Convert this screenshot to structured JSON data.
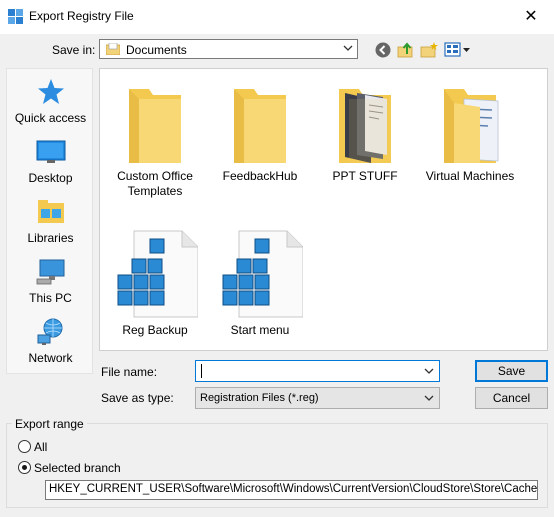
{
  "window": {
    "title": "Export Registry File",
    "close_glyph": "✕"
  },
  "savein": {
    "label": "Save in:",
    "value": "Documents"
  },
  "toolbar": {
    "icons": [
      "back-icon",
      "up-folder-icon",
      "new-folder-icon",
      "view-menu-icon"
    ]
  },
  "places": [
    {
      "label": "Quick access",
      "icon": "quick-access-star-icon"
    },
    {
      "label": "Desktop",
      "icon": "desktop-icon"
    },
    {
      "label": "Libraries",
      "icon": "libraries-icon"
    },
    {
      "label": "This PC",
      "icon": "this-pc-icon"
    },
    {
      "label": "Network",
      "icon": "network-icon"
    }
  ],
  "files": [
    {
      "name": "Custom Office Templates",
      "type": "folder"
    },
    {
      "name": "FeedbackHub",
      "type": "folder"
    },
    {
      "name": "PPT STUFF",
      "type": "folder"
    },
    {
      "name": "Virtual Machines",
      "type": "folder"
    },
    {
      "name": "Reg Backup",
      "type": "reg-file"
    },
    {
      "name": "Start menu",
      "type": "reg-file"
    }
  ],
  "filename": {
    "label": "File name:",
    "value": ""
  },
  "filetype": {
    "label": "Save as type:",
    "value": "Registration Files (*.reg)"
  },
  "buttons": {
    "save": "Save",
    "cancel": "Cancel"
  },
  "export_range": {
    "title": "Export range",
    "all_label": "All",
    "selected_label": "Selected branch",
    "selected": "Selected branch",
    "branch_value": "HKEY_CURRENT_USER\\Software\\Microsoft\\Windows\\CurrentVersion\\CloudStore\\Store\\Cache\\Def"
  },
  "colors": {
    "folder": "#f8d775",
    "accent": "#0078d7",
    "registry_cube": "#2a8ad4"
  }
}
